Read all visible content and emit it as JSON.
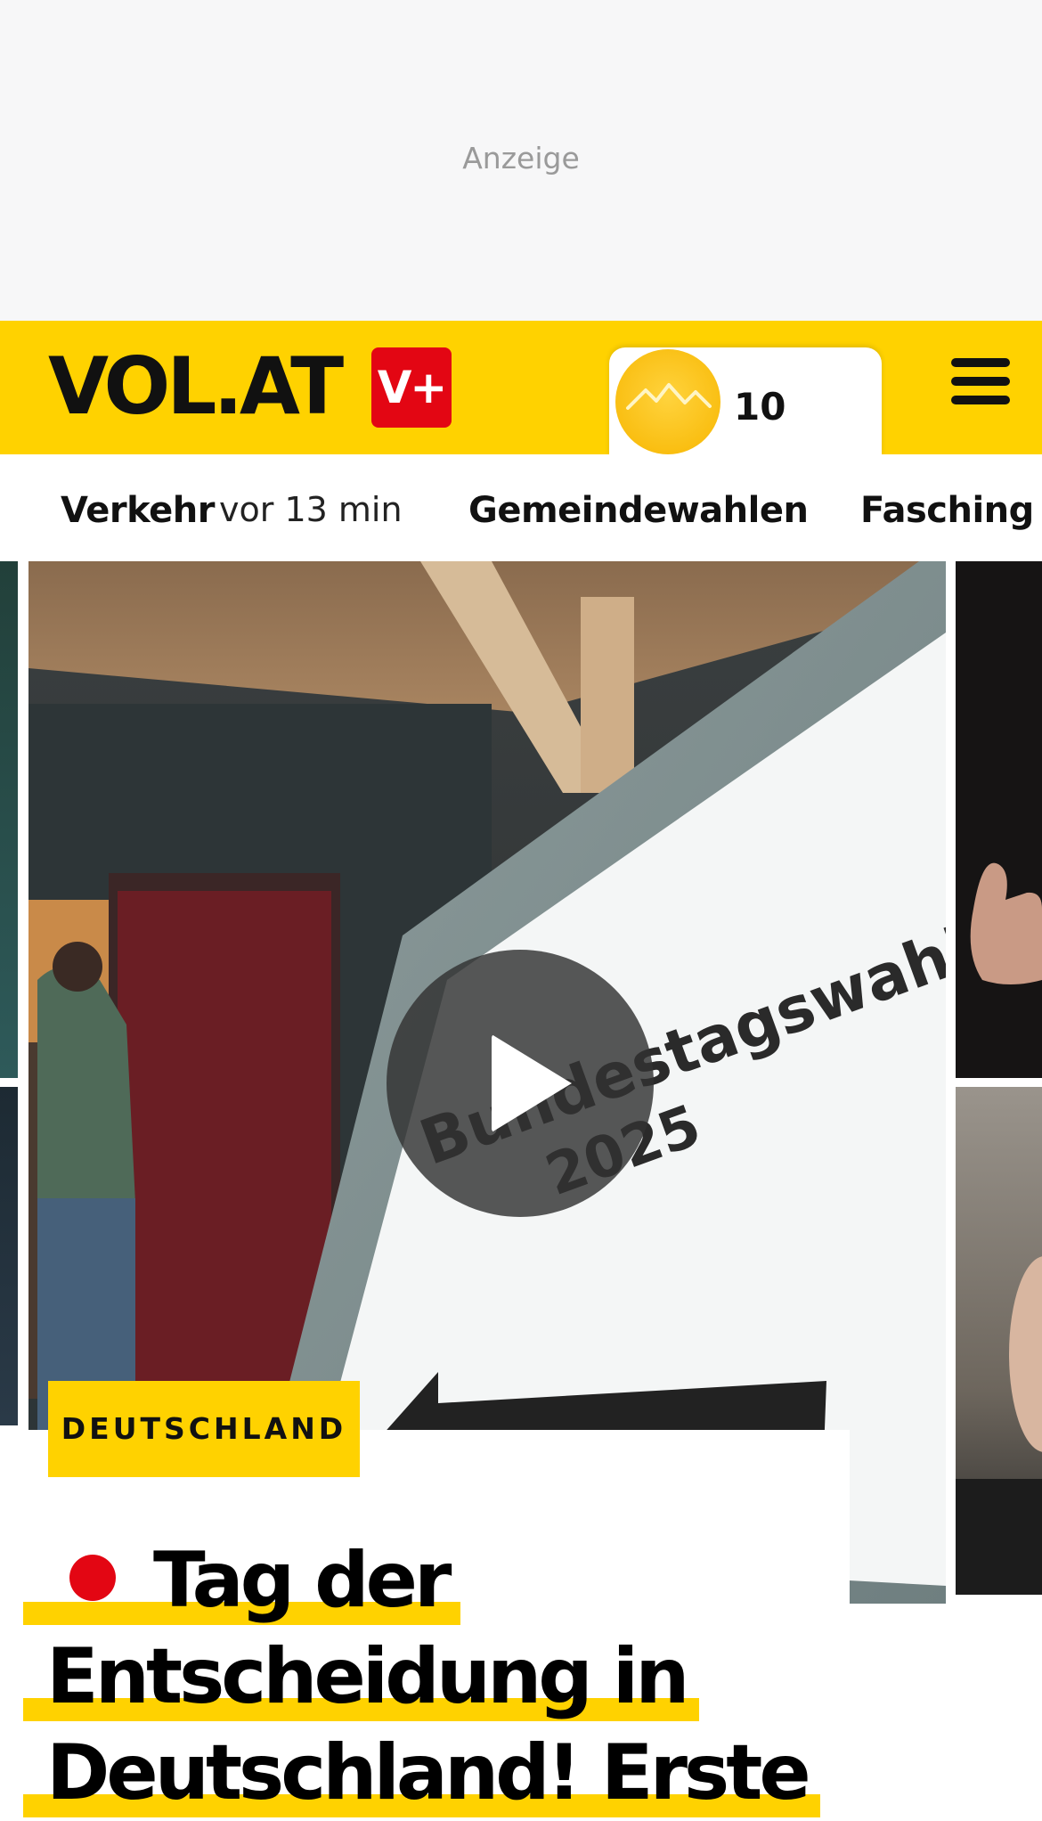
{
  "ad": {
    "label": "Anzeige"
  },
  "header": {
    "logo_text": "VOL.AT",
    "vplus_label": "V+",
    "weather": {
      "temperature": "10",
      "icon": "sun-mountains-icon"
    },
    "menu_icon": "hamburger-menu-icon",
    "colors": {
      "brand_yellow": "#ffd200",
      "brand_red": "#e30613"
    }
  },
  "nav": {
    "items": [
      {
        "label": "Verkehr",
        "time": "vor 13 min"
      },
      {
        "label": "Gemeindewahlen"
      },
      {
        "label": "Fasching"
      }
    ]
  },
  "hero": {
    "sign_text_1": "Bundestagswahl",
    "sign_text_2": "2025",
    "category": "DEUTSCHLAND",
    "headline_line_1": "Tag der",
    "headline_line_2": "Entscheidung in",
    "headline_line_3": "Deutschland! Erste",
    "live_indicator": "live-dot",
    "play_icon": "play-icon"
  }
}
